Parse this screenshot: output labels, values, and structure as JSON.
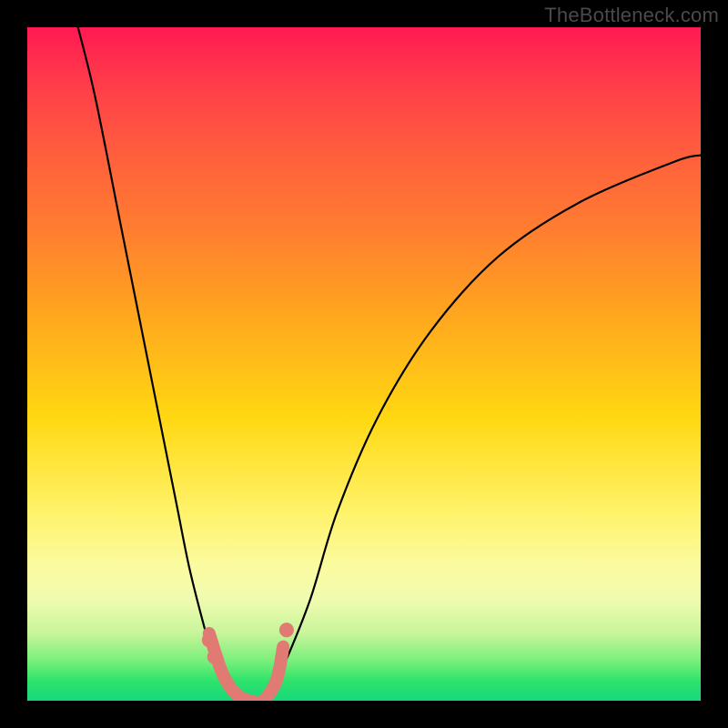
{
  "watermark": "TheBottleneck.com",
  "colors": {
    "background": "#000000",
    "gradient_top": "#ff1a52",
    "gradient_mid": "#ffd812",
    "gradient_bottom": "#17d87a",
    "curve": "#000000",
    "accent": "#e07a72"
  },
  "chart_data": {
    "type": "line",
    "title": "",
    "xlabel": "",
    "ylabel": "",
    "xlim": [
      0,
      100
    ],
    "ylim": [
      0,
      100
    ],
    "grid": false,
    "legend": false,
    "note": "No axis ticks or labels are shown. Values below estimated from curve geometry (x left→right 0–100, y bottom→top 0–100). The black V-shaped bottleneck curve reaches ~0 near x≈32 and rises steeply on both sides. Pink accent segment marks the trough x≈27–38, y≈0–10; pink dots sit on the curve near the trough and just above on the right branch.",
    "series": [
      {
        "name": "bottleneck-curve",
        "x": [
          7,
          10,
          14,
          18,
          22,
          24,
          26,
          28,
          30,
          32,
          34,
          36,
          38,
          42,
          46,
          52,
          60,
          70,
          82,
          96,
          100
        ],
        "y": [
          102,
          90,
          70,
          50,
          30,
          20,
          12,
          5,
          1,
          0,
          0,
          1,
          5,
          15,
          28,
          42,
          55,
          66,
          74,
          80,
          81
        ]
      },
      {
        "name": "accent-trough",
        "x": [
          27,
          29,
          31,
          33,
          35,
          37,
          38
        ],
        "y": [
          10,
          4,
          1,
          0,
          0,
          3,
          8
        ]
      }
    ],
    "points": [
      {
        "name": "dot-upper-right",
        "x": 38.5,
        "y": 10.5
      },
      {
        "name": "dot-left-upper",
        "x": 27.0,
        "y": 9.0
      },
      {
        "name": "dot-left-lower",
        "x": 27.8,
        "y": 6.5
      }
    ]
  }
}
